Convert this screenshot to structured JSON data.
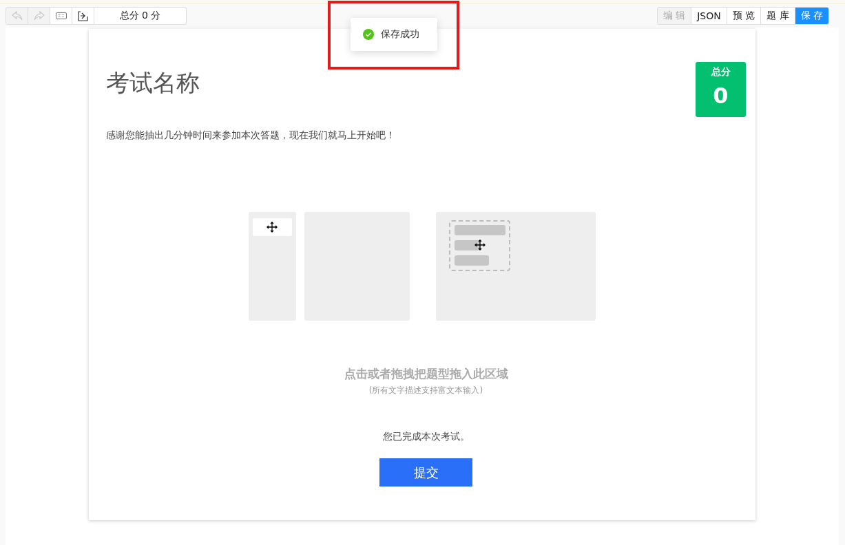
{
  "toolbar": {
    "left_buttons": [
      {
        "kind": "undo",
        "disabled": true
      },
      {
        "kind": "redo",
        "disabled": true
      },
      {
        "kind": "keyboard",
        "disabled": false
      },
      {
        "kind": "import",
        "disabled": false
      }
    ],
    "total_score": "总分 0 分",
    "right_buttons": [
      {
        "label": "编 辑",
        "disabled": true,
        "primary": false
      },
      {
        "label": "JSON",
        "disabled": false,
        "primary": false
      },
      {
        "label": "预 览",
        "disabled": false,
        "primary": false
      },
      {
        "label": "题 库",
        "disabled": false,
        "primary": false
      },
      {
        "label": "保 存",
        "disabled": false,
        "primary": true
      }
    ]
  },
  "toast": {
    "message": "保存成功",
    "highlighted": true
  },
  "exam": {
    "title": "考试名称",
    "description": "感谢您能抽出几分钟时间来参加本次答题，现在我们就马上开始吧！",
    "score_badge": {
      "label": "总分",
      "value": "0"
    },
    "drop_hint": "点击或者拖拽把题型拖入此区域",
    "drop_subhint": "(所有文字描述支持富文本输入)",
    "completion": "您已完成本次考试。",
    "submit": "提交"
  }
}
